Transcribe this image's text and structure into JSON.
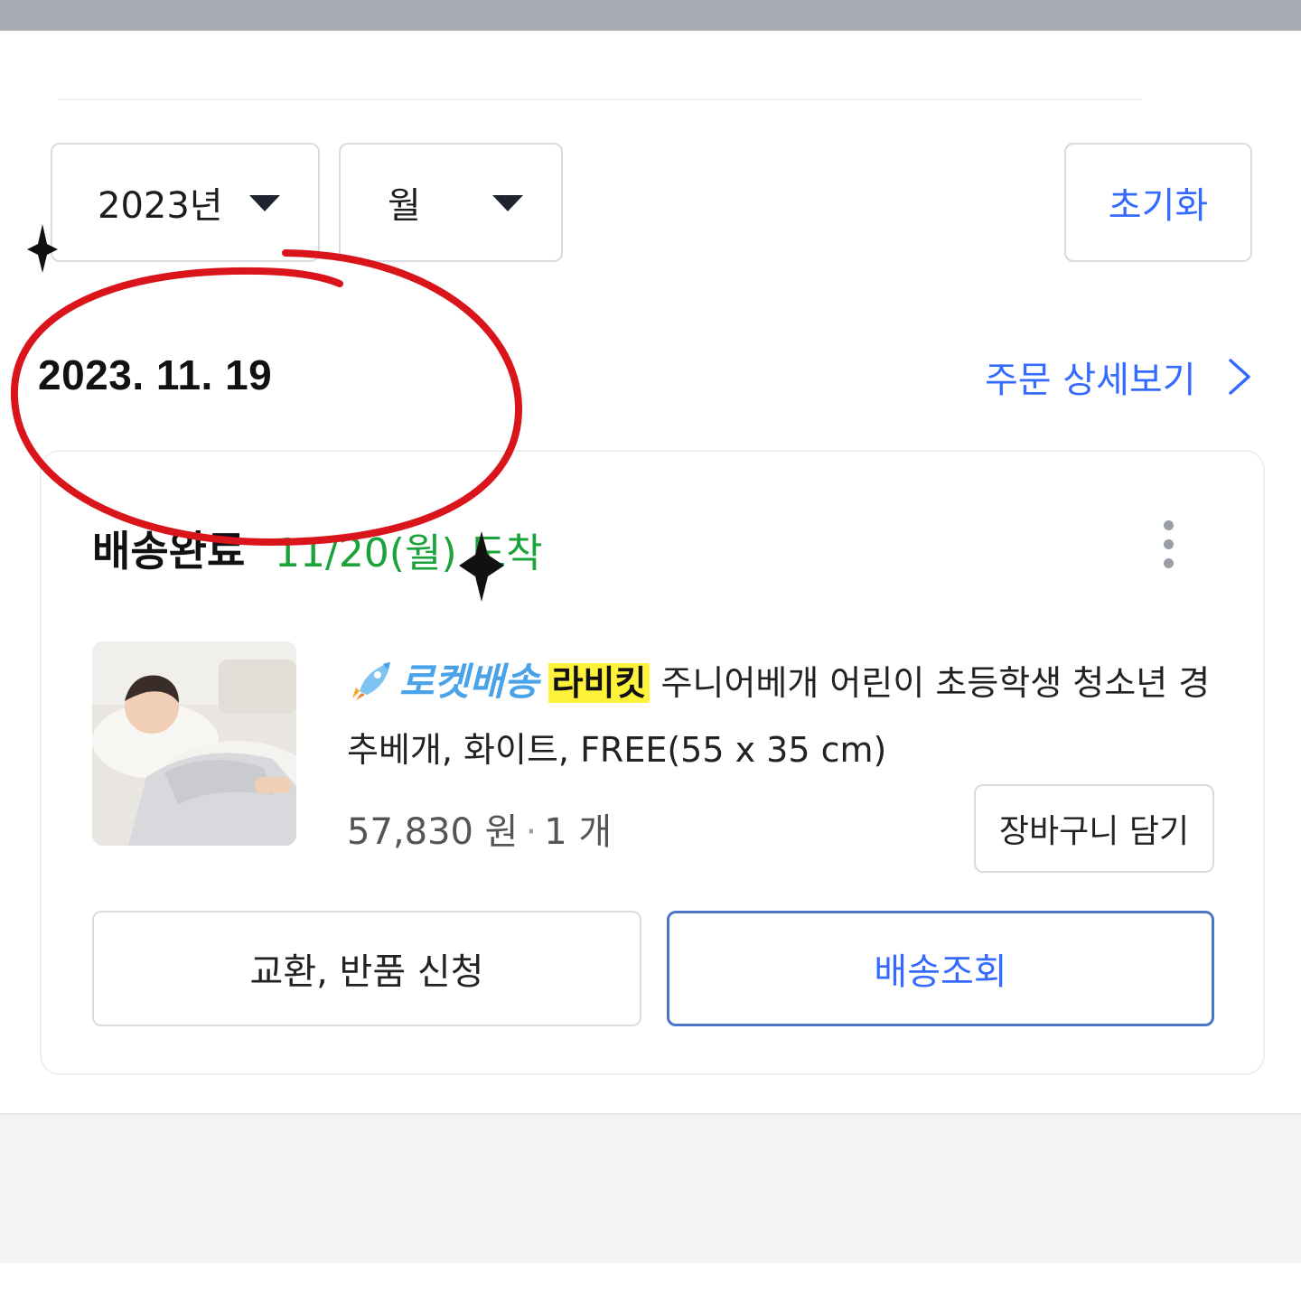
{
  "filters": {
    "year_label": "2023년",
    "month_label": "월",
    "reset_label": "초기화"
  },
  "order": {
    "date": "2023. 11. 19",
    "detail_link": "주문 상세보기",
    "status": "배송완료",
    "arrival": "11/20(월) 도착",
    "product": {
      "badge": "로켓배송",
      "brand": "라비킷",
      "name_rest": "주니어베개 어린이 초등학생 청소년 경추베개, 화이트, FREE(55 x 35 cm)",
      "price": "57,830 원",
      "separator": "·",
      "quantity": "1 개"
    },
    "cart_button": "장바구니 담기",
    "exchange_button": "교환, 반품 신청",
    "tracking_button": "배송조회"
  },
  "colors": {
    "accent_blue": "#346aff",
    "arrival_green": "#1aa33a",
    "highlight_yellow": "#fff23a",
    "annotation_red": "#d9141b"
  },
  "icons": [
    "caret-down-icon",
    "chevron-right-icon",
    "more-vertical-icon",
    "rocket-icon",
    "sparkle-icon"
  ]
}
